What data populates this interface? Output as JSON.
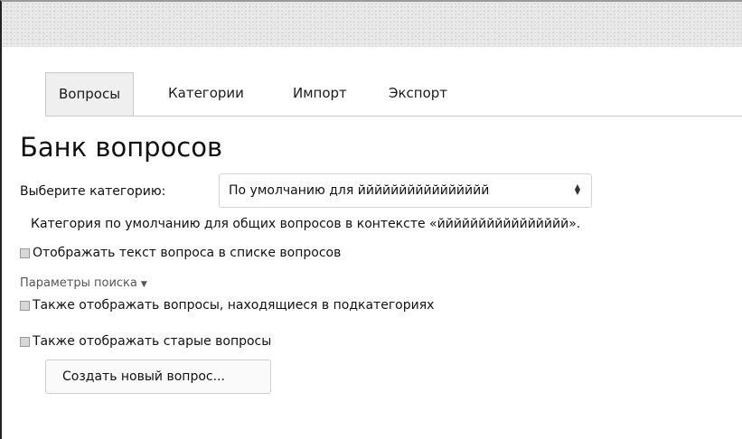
{
  "tabs": [
    {
      "label": "Вопросы",
      "active": true
    },
    {
      "label": "Категории",
      "active": false
    },
    {
      "label": "Импорт",
      "active": false
    },
    {
      "label": "Экспорт",
      "active": false
    }
  ],
  "page_title": "Банк вопросов",
  "category": {
    "label": "Выберите категорию:",
    "selected": "По умолчанию для йййййййййййййййй",
    "arrows_icon": "updown-arrows-icon"
  },
  "description": "Категория по умолчанию для общих вопросов в контексте «йййййййййййййййй».",
  "options": {
    "show_text": "Отображать текст вопроса в списке вопросов",
    "search_params": "Параметры поиска",
    "search_params_icon": "chevron-down-icon",
    "show_subcategories": "Также отображать вопросы, находящиеся в подкатегориях",
    "show_old": "Также отображать старые вопросы"
  },
  "create_button": "Создать новый вопрос..."
}
